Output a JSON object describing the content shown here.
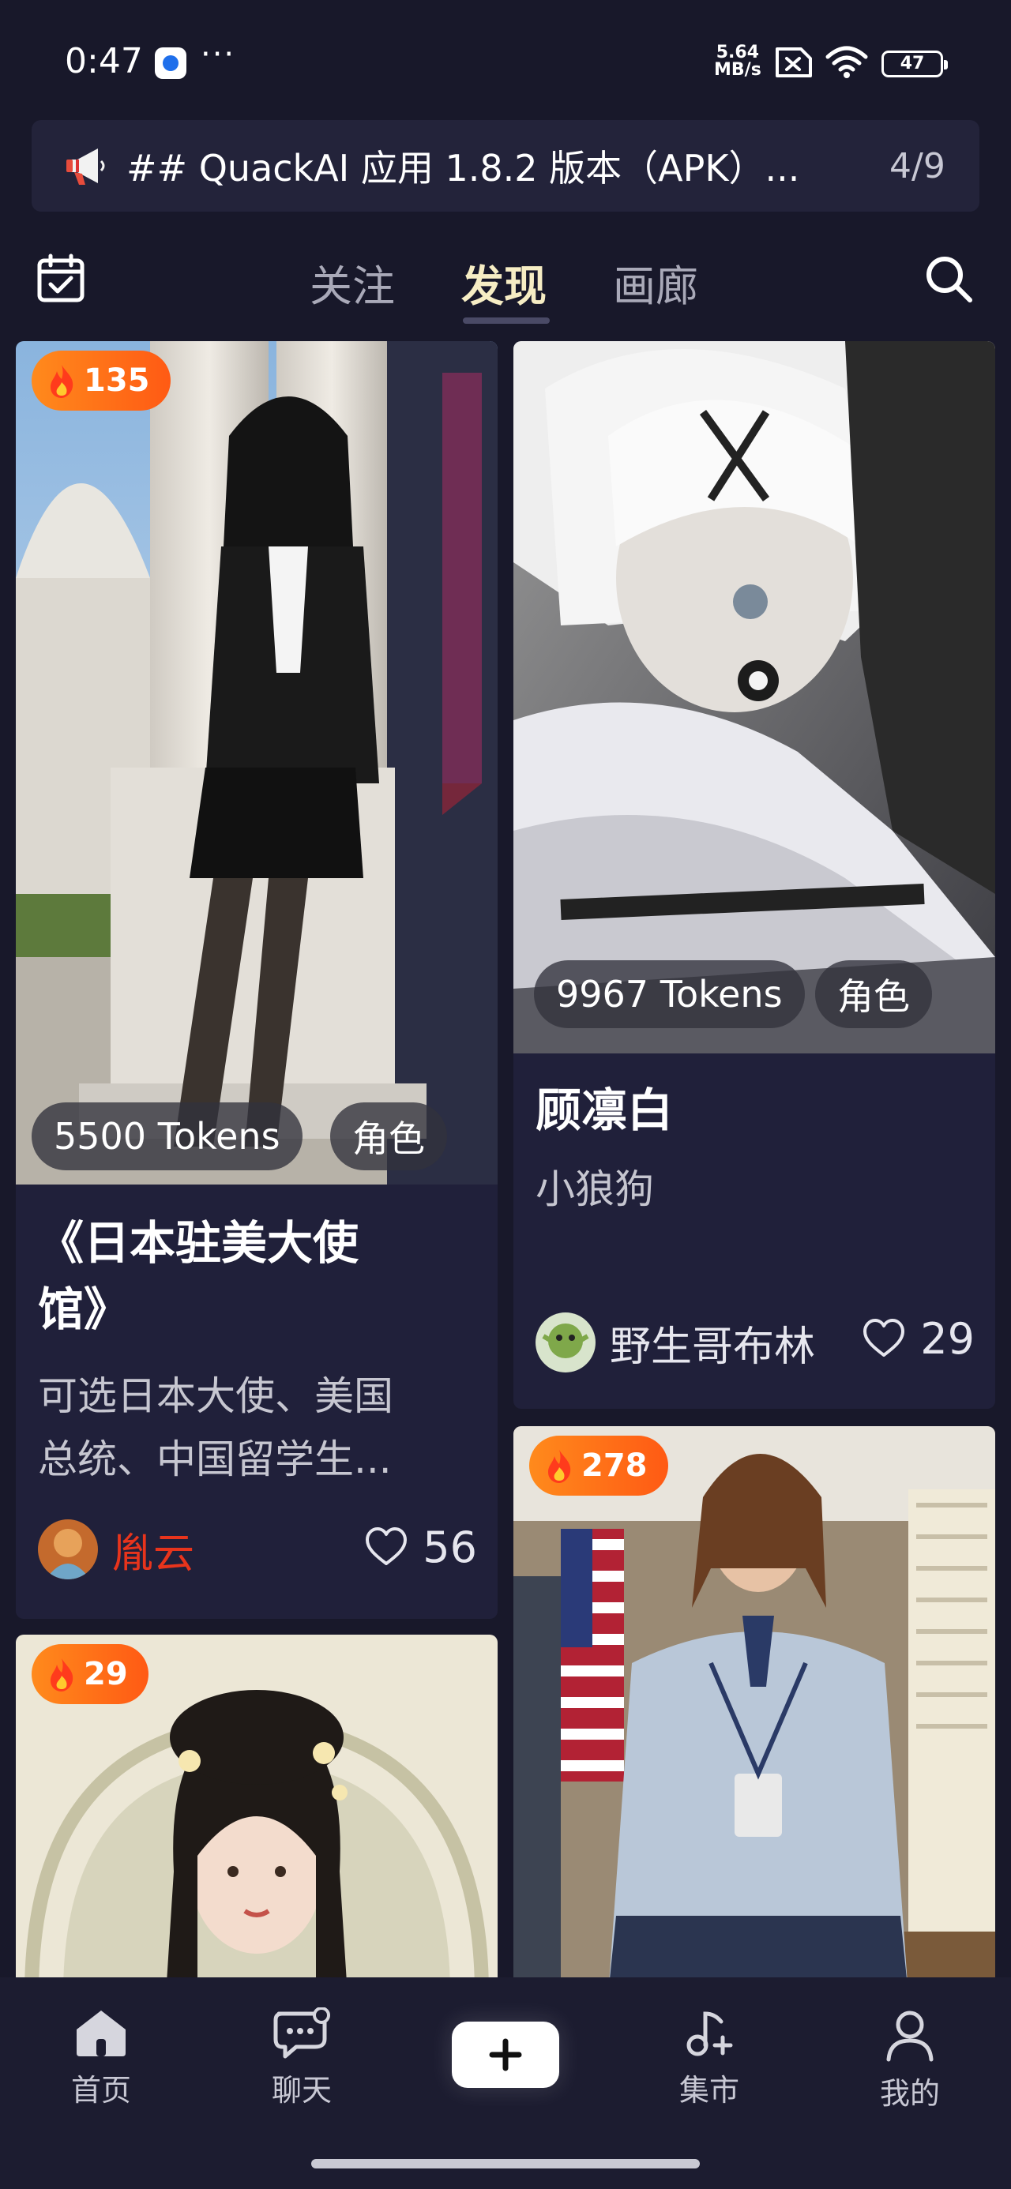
{
  "status_bar": {
    "time": "0:47",
    "more": "···",
    "net_speed_value": "5.64",
    "net_speed_unit": "MB/s",
    "battery": "47"
  },
  "banner": {
    "text": "## QuackAI 应用 1.8.2 版本（APK）...",
    "counter": "4/9"
  },
  "tabs": [
    {
      "label": "关注",
      "active": false
    },
    {
      "label": "发现",
      "active": true
    },
    {
      "label": "画廊",
      "active": false
    }
  ],
  "cards": [
    {
      "hot": "135",
      "tokens": "5500 Tokens",
      "tag": "角色",
      "title_line1": "《日本驻美大使",
      "title_line2": "馆》",
      "desc_line1": "可选日本大使、美国",
      "desc_line2": "总统、中国留学生...",
      "author": "胤云",
      "author_color": "#e8341c",
      "likes": "56"
    },
    {
      "tokens": "9967 Tokens",
      "tag": "角色",
      "title": "顾凛白",
      "desc": "小狼狗",
      "author": "野生哥布林",
      "likes": "29"
    },
    {
      "hot": "278"
    },
    {
      "hot": "29"
    }
  ],
  "bottom_nav": [
    {
      "label": "首页",
      "icon": "home-icon"
    },
    {
      "label": "聊天",
      "icon": "chat-icon"
    },
    {
      "label": "",
      "icon": "plus-icon"
    },
    {
      "label": "集市",
      "icon": "market-icon"
    },
    {
      "label": "我的",
      "icon": "profile-icon"
    }
  ],
  "colors": {
    "background": "#18182a",
    "active_tab": "#f6edc4",
    "hot_badge": "#ff6a18"
  }
}
